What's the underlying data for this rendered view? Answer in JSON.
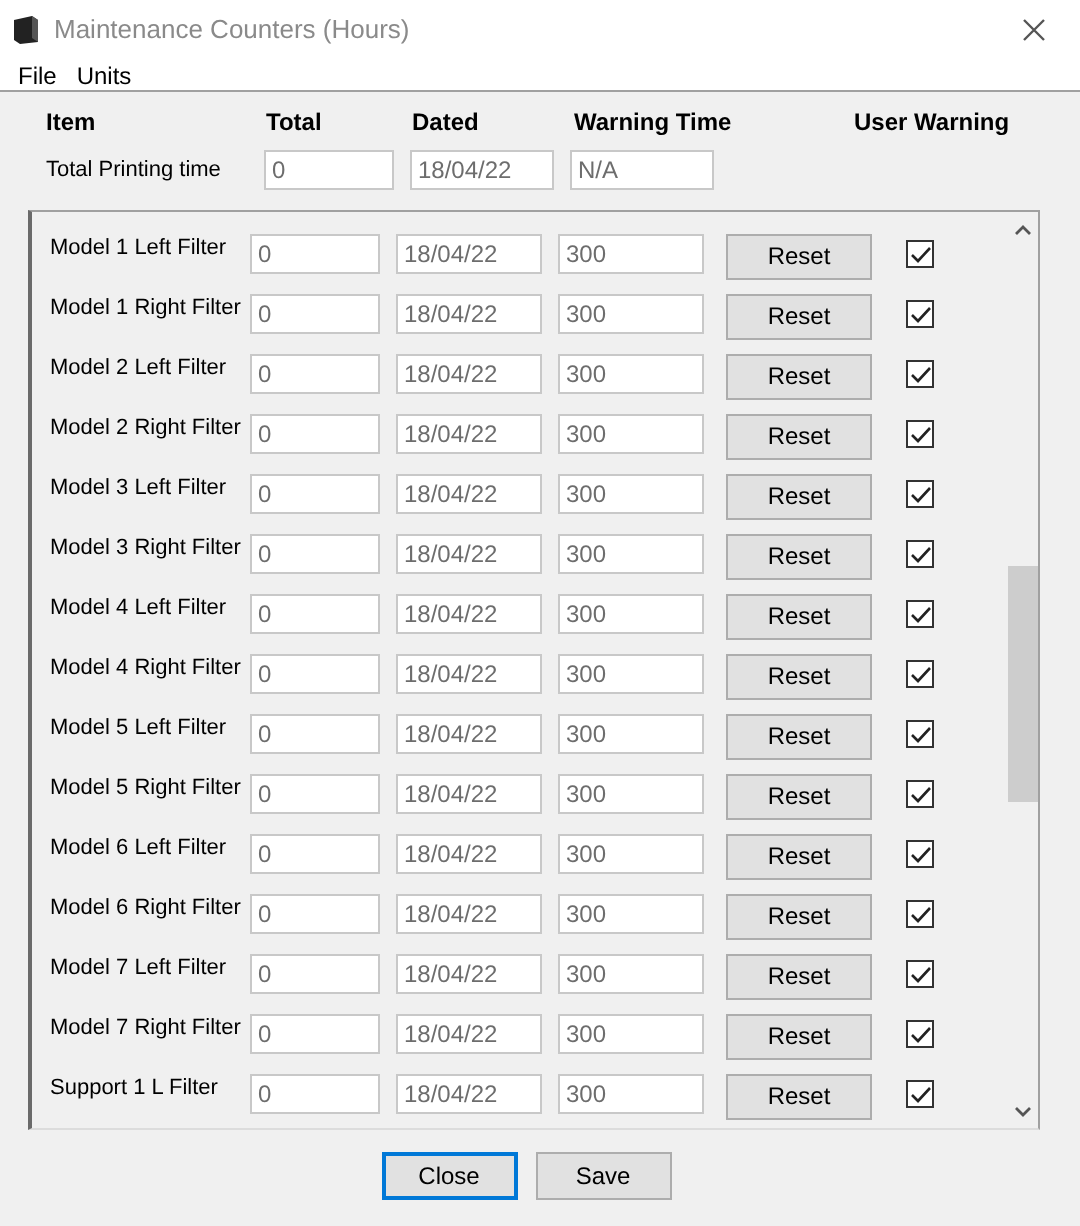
{
  "window": {
    "title": "Maintenance Counters (Hours)"
  },
  "menu": [
    "File",
    "Units"
  ],
  "columns": [
    "Item",
    "Total",
    "Dated",
    "Warning Time",
    "User Warning"
  ],
  "total_row": {
    "label": "Total Printing time",
    "total": "0",
    "dated": "18/04/22",
    "warning_time": "N/A"
  },
  "counters": [
    {
      "label": "Model 1 Left Filter",
      "total": "0",
      "dated": "18/04/22",
      "warning_time": "300",
      "button": "Reset",
      "checked": true
    },
    {
      "label": "Model 1 Right Filter",
      "total": "0",
      "dated": "18/04/22",
      "warning_time": "300",
      "button": "Reset",
      "checked": true
    },
    {
      "label": "Model 2 Left Filter",
      "total": "0",
      "dated": "18/04/22",
      "warning_time": "300",
      "button": "Reset",
      "checked": true
    },
    {
      "label": "Model 2 Right Filter",
      "total": "0",
      "dated": "18/04/22",
      "warning_time": "300",
      "button": "Reset",
      "checked": true
    },
    {
      "label": "Model 3 Left Filter",
      "total": "0",
      "dated": "18/04/22",
      "warning_time": "300",
      "button": "Reset",
      "checked": true
    },
    {
      "label": "Model 3 Right Filter",
      "total": "0",
      "dated": "18/04/22",
      "warning_time": "300",
      "button": "Reset",
      "checked": true
    },
    {
      "label": "Model 4 Left Filter",
      "total": "0",
      "dated": "18/04/22",
      "warning_time": "300",
      "button": "Reset",
      "checked": true
    },
    {
      "label": "Model 4 Right Filter",
      "total": "0",
      "dated": "18/04/22",
      "warning_time": "300",
      "button": "Reset",
      "checked": true
    },
    {
      "label": "Model 5 Left Filter",
      "total": "0",
      "dated": "18/04/22",
      "warning_time": "300",
      "button": "Reset",
      "checked": true
    },
    {
      "label": "Model 5 Right Filter",
      "total": "0",
      "dated": "18/04/22",
      "warning_time": "300",
      "button": "Reset",
      "checked": true
    },
    {
      "label": "Model 6 Left Filter",
      "total": "0",
      "dated": "18/04/22",
      "warning_time": "300",
      "button": "Reset",
      "checked": true
    },
    {
      "label": "Model 6 Right Filter",
      "total": "0",
      "dated": "18/04/22",
      "warning_time": "300",
      "button": "Reset",
      "checked": true
    },
    {
      "label": "Model 7 Left Filter",
      "total": "0",
      "dated": "18/04/22",
      "warning_time": "300",
      "button": "Reset",
      "checked": true
    },
    {
      "label": "Model 7 Right Filter",
      "total": "0",
      "dated": "18/04/22",
      "warning_time": "300",
      "button": "Reset",
      "checked": true
    },
    {
      "label": "Support 1 L Filter",
      "total": "0",
      "dated": "18/04/22",
      "warning_time": "300",
      "button": "Reset",
      "checked": true
    }
  ],
  "buttons": [
    {
      "label": "Close",
      "focused": true
    },
    {
      "label": "Save",
      "focused": false
    }
  ]
}
